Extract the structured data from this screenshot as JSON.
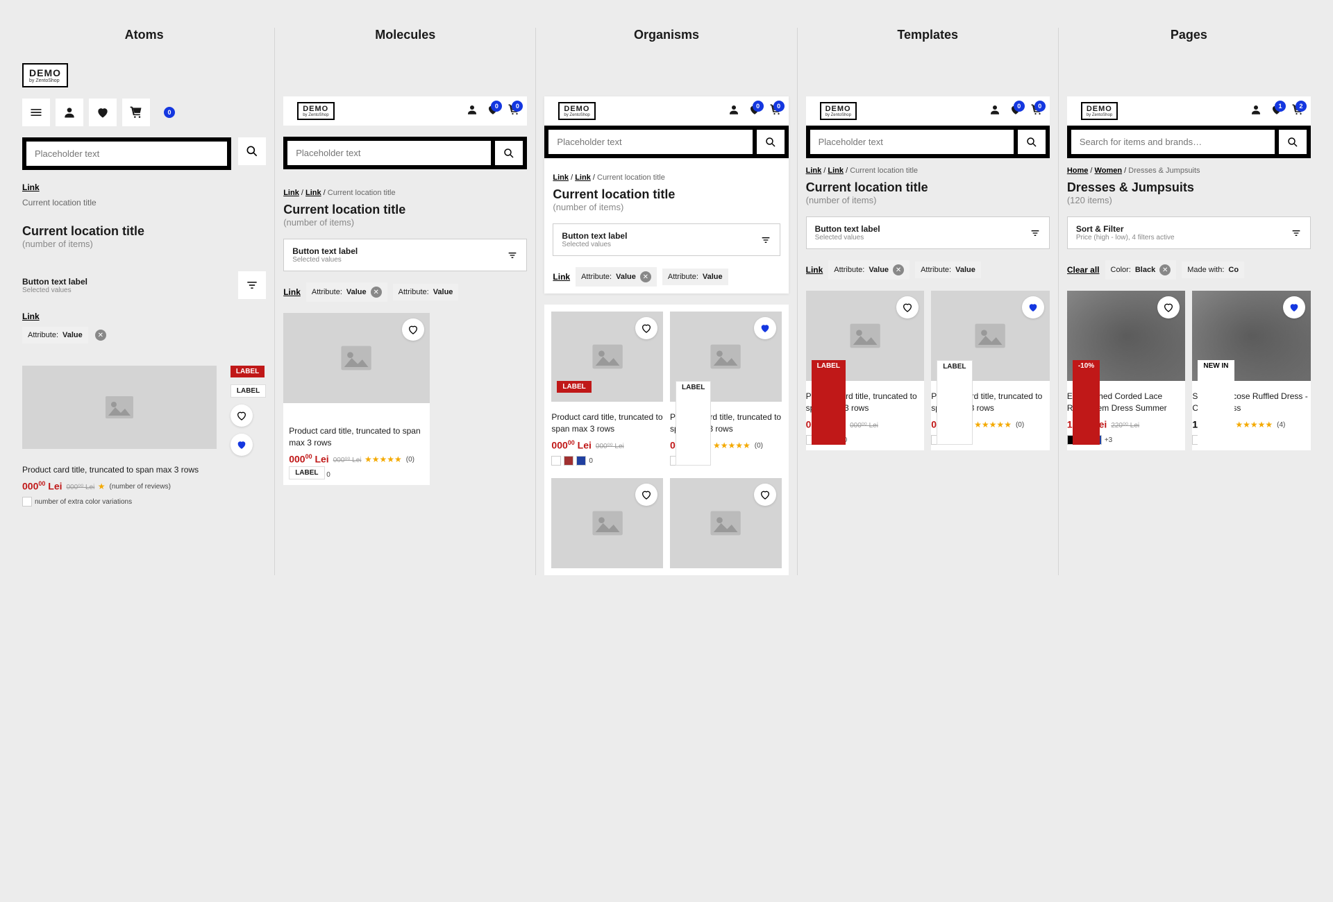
{
  "columns": {
    "atoms": "Atoms",
    "molecules": "Molecules",
    "organisms": "Organisms",
    "templates": "Templates",
    "pages": "Pages"
  },
  "logo": {
    "main": "DEMO",
    "sub": "by ZentoShop"
  },
  "badge_zero": "0",
  "search": {
    "placeholder_generic": "Placeholder text",
    "placeholder_real": "Search for items and brands…"
  },
  "link_text": "Link",
  "clear_all": "Clear all",
  "current_location_text": "Current location title",
  "items_text_generic": "(number of items)",
  "sort": {
    "label_generic": "Button text label",
    "sub_generic": "Selected values",
    "label_real": "Sort & Filter",
    "sub_real": "Price (high - low), 4 filters active"
  },
  "chip": {
    "attr": "Attribute:",
    "val": "Value",
    "color_attr": "Color:",
    "color_val": "Black",
    "made_attr": "Made with:",
    "made_val": "Co"
  },
  "labels": {
    "generic": "LABEL",
    "discount": "-10%",
    "newin": "NEW IN"
  },
  "product": {
    "title_generic": "Product card title, truncated to span max 3 rows",
    "price_main": "000",
    "price_cents": "00",
    "currency": "Lei",
    "old_price": "000⁰⁰ Lei",
    "reviews_generic": "(number of reviews)",
    "reviews_zero": "(0)",
    "reviews_four": "(4)",
    "extra_colors_text": "number of extra color variations",
    "extra_zero": "0",
    "extra_plus3": "+3"
  },
  "pages": {
    "breadcrumb": {
      "home": "Home",
      "women": "Women",
      "cur": "Dresses & Jumpsuits"
    },
    "title": "Dresses & Jumpsuits",
    "items": "(120 items)",
    "heart_badge": "1",
    "cart_badge": "2",
    "product1": {
      "title": "Embellished Corded Lace Ruffle-Hem Dress Summer",
      "price": "199",
      "cents": "99",
      "old": "220⁰⁰ Lei"
    },
    "product2": {
      "title": "Stretch Viscose Ruffled Dress - Cotton Dress",
      "price": "129",
      "cents": "00"
    }
  },
  "colors": {
    "accent": "#1437e0",
    "red": "#c01818",
    "star": "#f4a900"
  }
}
